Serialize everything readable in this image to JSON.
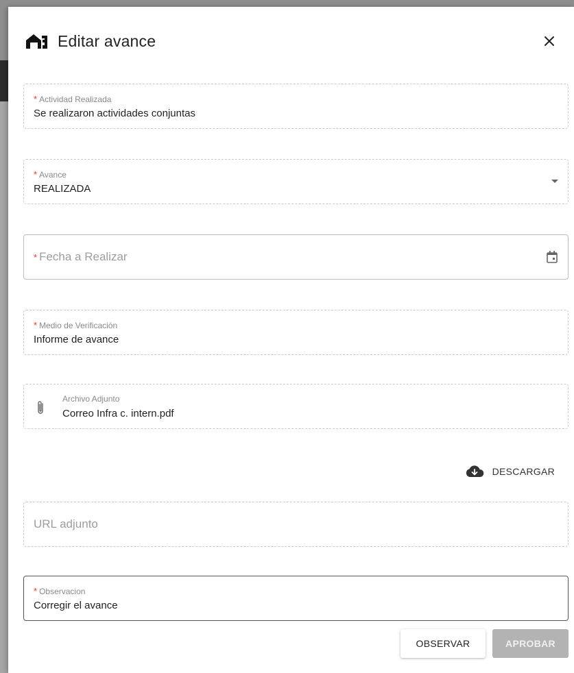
{
  "dialog": {
    "title": "Editar avance",
    "close_icon": "close-icon"
  },
  "fields": {
    "actividad": {
      "label": "Actividad Realizada",
      "required": "*",
      "value": "Se realizaron actividades conjuntas"
    },
    "avance": {
      "label": "Avance",
      "required": "*",
      "value": "REALIZADA"
    },
    "fecha": {
      "label": "Fecha a Realizar",
      "required": "*"
    },
    "medio": {
      "label": "Medio de Verificación",
      "required": "*",
      "value": "Informe de avance"
    },
    "archivo": {
      "label": "Archivo Adjunto",
      "value": "Correo Infra c. intern.pdf"
    },
    "url": {
      "placeholder": "URL adjunto"
    },
    "observacion": {
      "label": "Observacion",
      "required": "*",
      "value": "Corregir el avance"
    }
  },
  "actions": {
    "download_label": "DESCARGAR",
    "observar_label": "OBSERVAR",
    "aprobar_label": "APROBAR"
  },
  "colors": {
    "required": "#e53935",
    "disabled_button": "#b3b3b3"
  }
}
